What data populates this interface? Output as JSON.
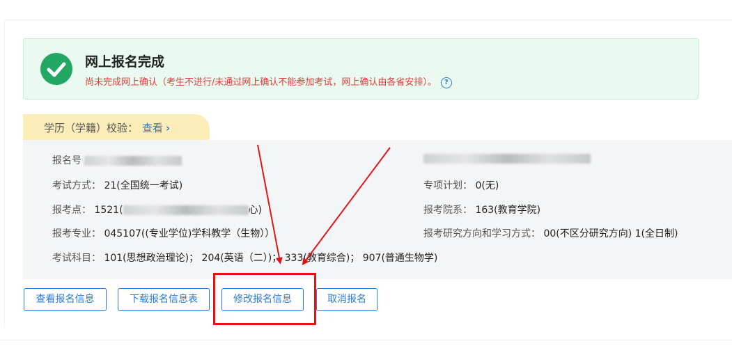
{
  "banner": {
    "title": "网上报名完成",
    "subtitle": "尚未完成网上确认（考生不进行/未通过网上确认不能参加考试，网上确认由各省安排）。",
    "help_icon": "?"
  },
  "verify": {
    "label": "学历（学籍）校验：",
    "link_text": "查看",
    "chevron": "›"
  },
  "info": {
    "reg_no_label": "报名号",
    "exam_method_label": "考试方式：",
    "exam_method_value": "21(全国统一考试)",
    "special_plan_label": "专项计划：",
    "special_plan_value": "0(无)",
    "exam_site_label": "报考点：",
    "exam_site_value_prefix": "1521(",
    "exam_site_value_suffix": "心)",
    "department_label": "报考院系：",
    "department_value": "163(教育学院)",
    "major_label": "报考专业：",
    "major_value": "045107((专业学位)学科教学（生物））",
    "direction_label": "报考研究方向和学习方式：",
    "direction_value": "00(不区分研究方向) 1(全日制)",
    "subjects_label": "考试科目：",
    "subjects_value": "101(思想政治理论)； 204(英语（二）)； 333(教育综合)； 907(普通生物学)"
  },
  "buttons": {
    "view": "查看报名信息",
    "download": "下载报名信息表",
    "modify": "修改报名信息",
    "cancel": "取消报名"
  },
  "colors": {
    "accent": "#2a7bd6",
    "success": "#22a862",
    "warning_text": "#e03b3b",
    "annotation": "#e11515"
  }
}
